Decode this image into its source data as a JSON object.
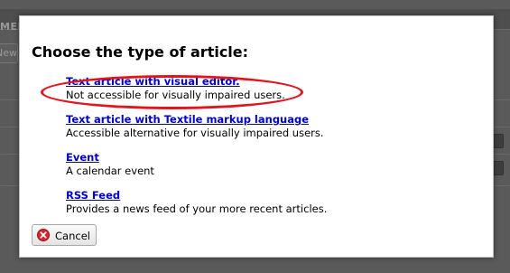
{
  "background": {
    "menu_bar_fragment": "MENU",
    "new_button_fragment": "New"
  },
  "dialog": {
    "title": "Choose the type of article:",
    "options": [
      {
        "label": "Text article with visual editor.",
        "description": "Not accessible for visually impaired users.",
        "highlighted": true
      },
      {
        "label": "Text article with Textile markup language",
        "description": "Accessible alternative for visually impaired users."
      },
      {
        "label": "Event",
        "description": "A calendar event"
      },
      {
        "label": "RSS Feed",
        "description": "Provides a news feed of your more recent articles."
      }
    ],
    "cancel_button": {
      "label": "Cancel",
      "icon": "cancel-icon"
    }
  },
  "colors": {
    "link": "#0000cc",
    "highlight_ring": "#e0151d",
    "overlay": "#5a5a5a"
  }
}
